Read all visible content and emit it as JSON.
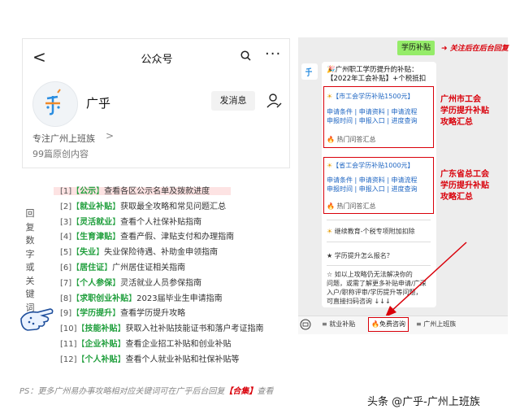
{
  "profile": {
    "nav_title": "公众号",
    "back_glyph": "<",
    "more_glyph": "···",
    "account_name": "广乎",
    "message_button": "发消息",
    "bio": "专注广州上班族",
    "bio_arrow": ">",
    "original_count": "99篇原创内容"
  },
  "keywords": {
    "side_label": "回复数字或关键词",
    "items": [
      {
        "num": "[1]",
        "key": "公示",
        "desc": "查看各区公示名单及拨款进度"
      },
      {
        "num": "[2]",
        "key": "就业补贴",
        "desc": "获取最全攻略和常见问题汇总"
      },
      {
        "num": "[3]",
        "key": "灵活就业",
        "desc": "查看个人社保补贴指南"
      },
      {
        "num": "[4]",
        "key": "生育津贴",
        "desc": "查看产假、津贴支付和办理指南"
      },
      {
        "num": "[5]",
        "key": "失业",
        "desc": "失业保险待遇、补助金申领指南"
      },
      {
        "num": "[6]",
        "key": "居住证",
        "desc": "广州居住证相关指南"
      },
      {
        "num": "[7]",
        "key": "个人参保",
        "desc": "灵活就业人员参保指南"
      },
      {
        "num": "[8]",
        "key": "求职创业补贴",
        "desc": "2023届毕业生申请指南"
      },
      {
        "num": "[9]",
        "key": "学历提升",
        "desc": "查看学历提升攻略"
      },
      {
        "num": "[10]",
        "key": "技能补贴",
        "desc": "获取入社补贴技能证书和落户考证指南"
      },
      {
        "num": "[11]",
        "key": "企业补贴",
        "desc": "查看企业招工补贴和创业补贴"
      },
      {
        "num": "[12]",
        "key": "个人补贴",
        "desc": "查看个人就业补贴和社保补贴等"
      }
    ]
  },
  "ps": {
    "prefix": "PS：更多广州易办事攻略相对应关键词可在广乎后台回复",
    "key": "【合集】",
    "suffix": "查看"
  },
  "chat": {
    "keyword_sent": "学历补贴",
    "reply_note": "关注后在后台回复",
    "title_line1": "🎉广州职工学历提升的补贴：",
    "title_line2": "【2022年工会补贴】+个税抵扣",
    "box1": {
      "head": "【市工会学历补贴1500元】",
      "line1": "申请条件 | 申请资料 | 申请流程",
      "line2": "申报时间 | 申报入口 | 进度查询",
      "foot": "🔥 热门问答汇总"
    },
    "box2": {
      "head": "【省工会学历补贴1000元】",
      "line1": "申请条件 | 申请资料 | 申请流程",
      "line2": "申报时间 | 申报入口 | 进度查询",
      "foot": "🔥 热门问答汇总"
    },
    "label1": [
      "广州市工会",
      "学历提升补贴",
      "攻略汇总"
    ],
    "label2": [
      "广东省总工会",
      "学历提升补贴",
      "攻略汇总"
    ],
    "extra1": "继续教育-个税专项附加扣除",
    "extra2": "★ 学历提升怎么报名？",
    "note_lines": [
      "☆ 如以上攻略仍无法解决你的",
      "问题，或需了解更多补贴申请/广深",
      "入户/职称评审/学历提升等问题，",
      "可直接扫码咨询 ↓↓↓"
    ],
    "bar_items": [
      "就业补贴",
      "免费咨询",
      "广州上班族"
    ]
  },
  "watermark": "头条 @广乎-广州上班族",
  "colors": {
    "accent_red": "#d9000a",
    "keyword_green": "#1e9e3b",
    "link_blue": "#2067c3",
    "wechat_green": "#95ec69"
  }
}
